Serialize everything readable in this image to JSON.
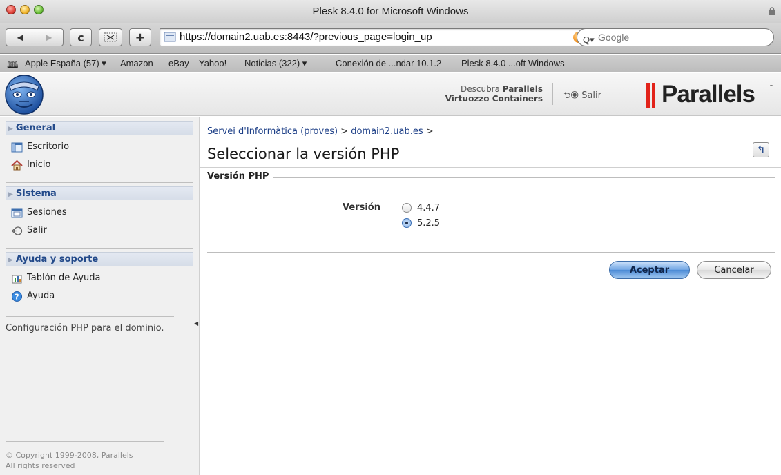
{
  "browser": {
    "window_title": "Plesk 8.4.0 for Microsoft Windows",
    "nav_back": "◀",
    "nav_forward": "▶",
    "reload": "c",
    "add_tab": "+",
    "url": "https://domain2.uab.es:8443/?previous_page=login_up",
    "search_placeholder": "Google",
    "bookmarks": [
      "Apple España (57) ▾",
      "Amazon",
      "eBay",
      "Yahoo!",
      "Noticias (322) ▾",
      "Conexión de ...ndar 10.1.2",
      "Plesk 8.4.0 ...oft Windows"
    ]
  },
  "header": {
    "promo_line1": "Descubra ",
    "promo_brand": "Parallels",
    "promo_line2": "Virtuozzo Containers",
    "logout_label": "Salir",
    "brand_name": "Parallels",
    "brand_tm": "™"
  },
  "sidebar": {
    "sections": [
      {
        "title": "General",
        "items": [
          {
            "label": "Escritorio",
            "icon": "desktop-icon"
          },
          {
            "label": "Inicio",
            "icon": "home-icon"
          }
        ]
      },
      {
        "title": "Sistema",
        "items": [
          {
            "label": "Sesiones",
            "icon": "sessions-icon"
          },
          {
            "label": "Salir",
            "icon": "logout-icon"
          }
        ]
      },
      {
        "title": "Ayuda y soporte",
        "items": [
          {
            "label": "Tablón de Ayuda",
            "icon": "helpdesk-icon"
          },
          {
            "label": "Ayuda",
            "icon": "help-icon"
          }
        ]
      }
    ],
    "description": "Configuración PHP para el dominio.",
    "copyright_line1": "© Copyright 1999-2008, Parallels",
    "copyright_line2": "All rights reserved"
  },
  "main": {
    "breadcrumb": {
      "link1": "Servei d'Informàtica (proves)",
      "sep1": " > ",
      "link2": "domain2.uab.es",
      "sep2": " >"
    },
    "title": "Seleccionar la versión PHP",
    "up_label": "↰",
    "fieldset_legend": "Versión PHP",
    "field_label": "Versión",
    "options": [
      {
        "label": "4.4.7",
        "selected": false
      },
      {
        "label": "5.2.5",
        "selected": true
      }
    ],
    "ok_label": "Aceptar",
    "cancel_label": "Cancelar"
  },
  "colors": {
    "accent_link": "#1d3f87",
    "section_title": "#234a8a",
    "brand_red": "#e2231a",
    "ok_button": "#6ea4e3"
  }
}
